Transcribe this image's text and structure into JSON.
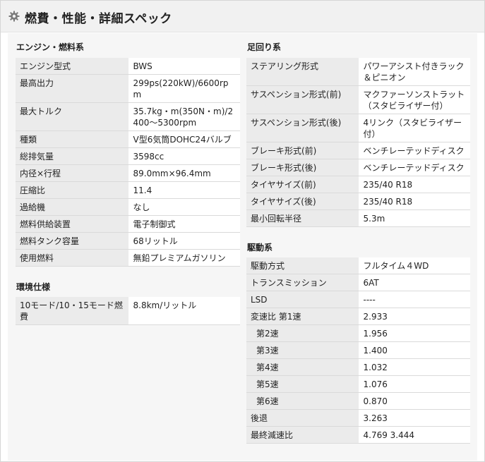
{
  "header": {
    "title": "燃費・性能・詳細スペック",
    "icon": "gear-icon"
  },
  "engine": {
    "title": "エンジン・燃料系",
    "rows": [
      {
        "label": "エンジン型式",
        "value": "BWS"
      },
      {
        "label": "最高出力",
        "value": "299ps(220kW)/6600rpm"
      },
      {
        "label": "最大トルク",
        "value": "35.7kg・m(350N・m)/2400〜5300rpm"
      },
      {
        "label": "種類",
        "value": "V型6気筒DOHC24バルブ"
      },
      {
        "label": "総排気量",
        "value": "3598cc"
      },
      {
        "label": "内径×行程",
        "value": "89.0mm×96.4mm"
      },
      {
        "label": "圧縮比",
        "value": "11.4"
      },
      {
        "label": "過給機",
        "value": "なし"
      },
      {
        "label": "燃料供給装置",
        "value": "電子制御式"
      },
      {
        "label": "燃料タンク容量",
        "value": "68リットル"
      },
      {
        "label": "使用燃料",
        "value": "無鉛プレミアムガソリン"
      }
    ]
  },
  "environment": {
    "title": "環境仕様",
    "rows": [
      {
        "label": "10モード/10・15モード燃費",
        "value": "8.8km/リットル"
      }
    ]
  },
  "suspension": {
    "title": "足回り系",
    "rows": [
      {
        "label": "ステアリング形式",
        "value": "パワーアシスト付きラック＆ピニオン"
      },
      {
        "label": "サスペンション形式(前)",
        "value": "マクファーソンストラット（スタビライザー付）"
      },
      {
        "label": "サスペンション形式(後)",
        "value": "4リンク（スタビライザー付）"
      },
      {
        "label": "ブレーキ形式(前)",
        "value": "ベンチレーテッドディスク"
      },
      {
        "label": "ブレーキ形式(後)",
        "value": "ベンチレーテッドディスク"
      },
      {
        "label": "タイヤサイズ(前)",
        "value": "235/40 R18"
      },
      {
        "label": "タイヤサイズ(後)",
        "value": "235/40 R18"
      },
      {
        "label": "最小回転半径",
        "value": "5.3m"
      }
    ]
  },
  "drivetrain": {
    "title": "駆動系",
    "rows": [
      {
        "label": "駆動方式",
        "value": "フルタイム４WD"
      },
      {
        "label": "トランスミッション",
        "value": "6AT"
      },
      {
        "label": "LSD",
        "value": "----"
      },
      {
        "label": "変速比 第1速",
        "value": "2.933"
      },
      {
        "label": "第2速",
        "value": "1.956"
      },
      {
        "label": "第3速",
        "value": "1.400"
      },
      {
        "label": "第4速",
        "value": "1.032"
      },
      {
        "label": "第5速",
        "value": "1.076"
      },
      {
        "label": "第6速",
        "value": "0.870"
      },
      {
        "label": "後退",
        "value": "3.263"
      },
      {
        "label": "最終減速比",
        "value": "4.769 3.444"
      }
    ]
  }
}
